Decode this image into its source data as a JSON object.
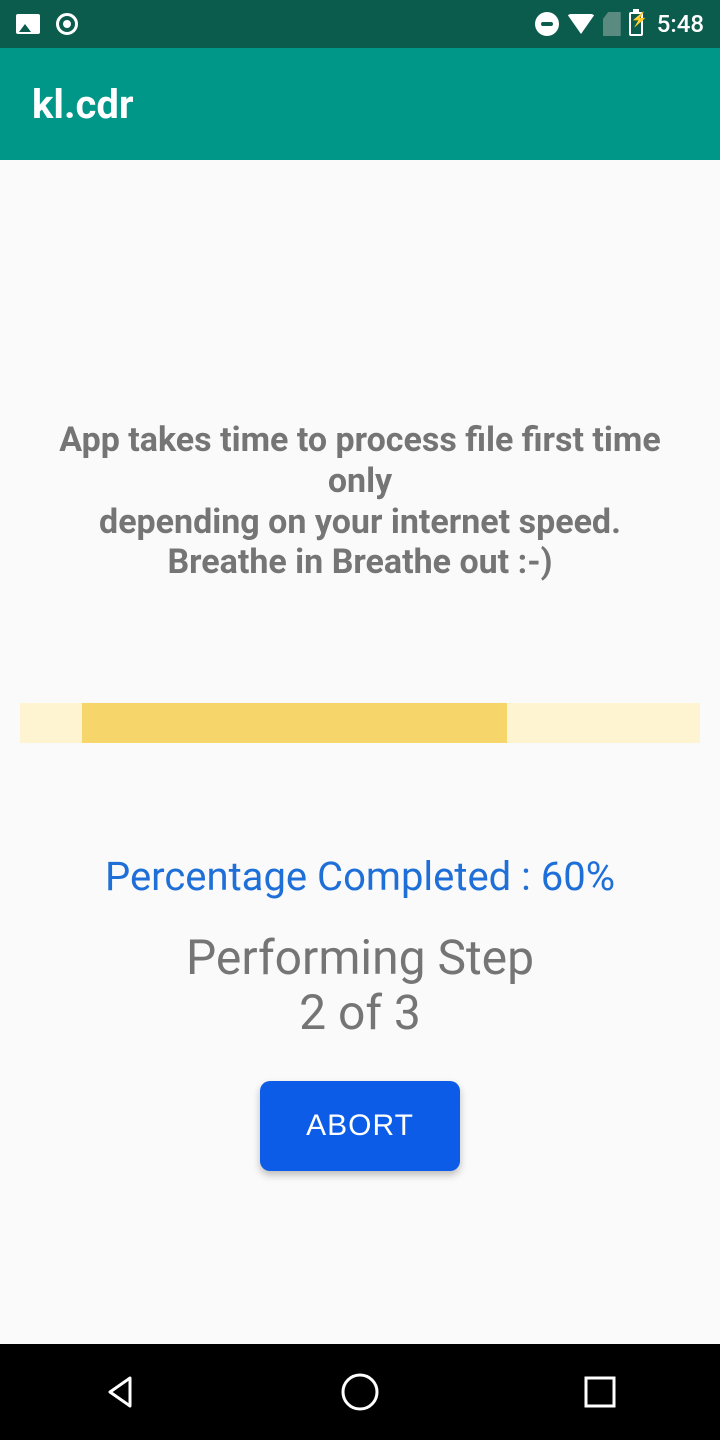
{
  "status_bar": {
    "time": "5:48"
  },
  "app_bar": {
    "title": "kl.cdr"
  },
  "content": {
    "info_line1": "App takes time to process file first time only",
    "info_line2": "depending on your internet speed.",
    "info_line3": "Breathe in Breathe out :-)",
    "percentage_label": "Percentage Completed : 60%",
    "step_line1": "Performing Step",
    "step_line2": "2 of 3",
    "abort_label": "ABORT",
    "progress_percent": 60
  }
}
